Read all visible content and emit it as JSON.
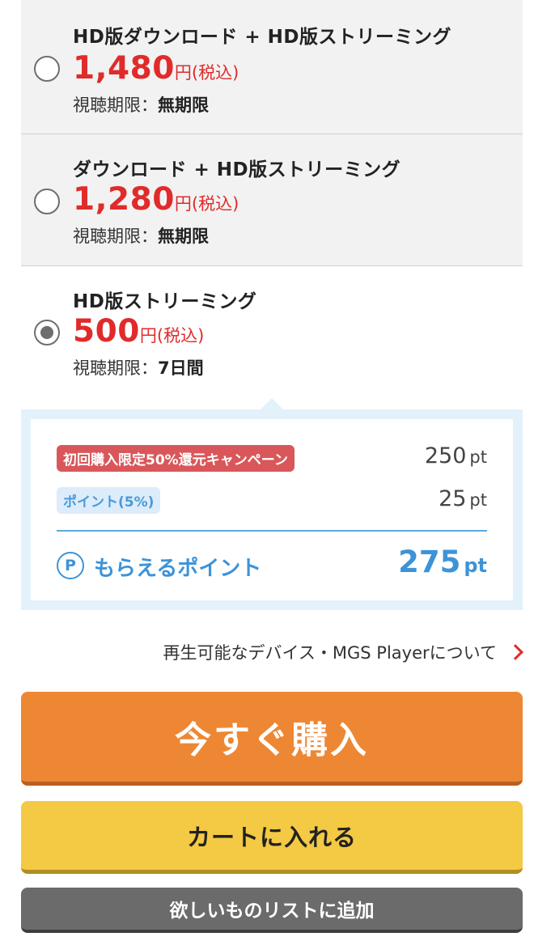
{
  "options": [
    {
      "title": "HD版ダウンロード + HD版ストリーミング",
      "price": "1,480",
      "currency": "円",
      "tax": "(税込)",
      "period_label": "視聴期限：",
      "period_value": "無期限",
      "selected": false
    },
    {
      "title": "ダウンロード + HD版ストリーミング",
      "price": "1,280",
      "currency": "円",
      "tax": "(税込)",
      "period_label": "視聴期限：",
      "period_value": "無期限",
      "selected": false
    },
    {
      "title": "HD版ストリーミング",
      "price": "500",
      "currency": "円",
      "tax": "(税込)",
      "period_label": "視聴期限：",
      "period_value": "7日間",
      "selected": true
    }
  ],
  "points": {
    "campaign_label": "初回購入限定50%還元キャンペーン",
    "campaign_value": "250",
    "base_label": "ポイント(5%)",
    "base_value": "25",
    "unit": "pt",
    "earn_icon": "P",
    "earn_label": "もらえるポイント",
    "earn_value": "275"
  },
  "device_link": {
    "label": "再生可能なデバイス・MGS Playerについて",
    "icon": "chevron-right-icon"
  },
  "buttons": {
    "buy": "今すぐ購入",
    "cart": "カートに入れる",
    "wishlist": "欲しいものリストに追加"
  },
  "colors": {
    "price_red": "#e02b2b",
    "points_blue": "#3d93d8",
    "buy_orange": "#ee8733",
    "cart_yellow": "#f4c943",
    "wishlist_gray": "#6b6b6b",
    "campaign_badge": "#d9575a"
  }
}
